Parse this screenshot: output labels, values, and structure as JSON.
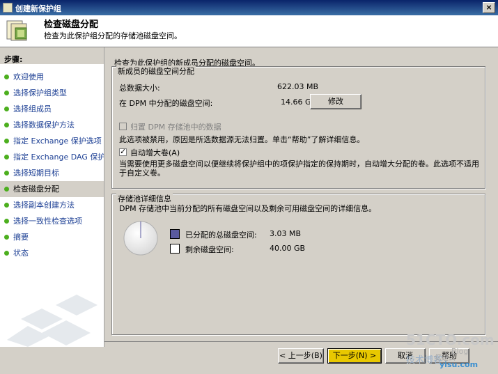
{
  "window": {
    "title": "创建新保护组",
    "close_glyph": "×"
  },
  "header": {
    "title": "检查磁盘分配",
    "subtitle": "检查为此保护组分配的存储池磁盘空间。"
  },
  "sidebar": {
    "heading": "步骤:",
    "items": [
      {
        "label": "欢迎使用"
      },
      {
        "label": "选择保护组类型"
      },
      {
        "label": "选择组成员"
      },
      {
        "label": "选择数据保护方法"
      },
      {
        "label": "指定 Exchange 保护选项"
      },
      {
        "label": "指定 Exchange DAG 保护"
      },
      {
        "label": "选择短期目标"
      },
      {
        "label": "检查磁盘分配",
        "active": true
      },
      {
        "label": "选择副本创建方法"
      },
      {
        "label": "选择一致性检查选项"
      },
      {
        "label": "摘要"
      },
      {
        "label": "状态"
      }
    ]
  },
  "main": {
    "intro": "检查为此保护组的新成员分配的磁盘空间。",
    "new_member_group": {
      "label": "新成员的磁盘空间分配",
      "total_size_label": "总数据大小:",
      "total_size_value": "622.03 MB",
      "dpm_space_label": "在 DPM 中分配的磁盘空间:",
      "dpm_space_value": "14.66 GB",
      "modify_button": "修改",
      "archive_checkbox_label": "归置 DPM 存储池中的数据",
      "archive_disabled_note": "此选项被禁用，原因是所选数据源无法归置。单击“帮助”了解详细信息。",
      "auto_grow_label": "自动增大卷(A)",
      "auto_grow_checked": true,
      "auto_grow_description": "当需要使用更多磁盘空间以便继续将保护组中的项保护指定的保持期时，自动增大分配的卷。此选项不适用于自定义卷。"
    },
    "pool_group": {
      "label": "存储池详细信息",
      "description": "DPM 存储池中当前分配的所有磁盘空间以及剩余可用磁盘空间的详细信息。",
      "allocated_label": "已分配的总磁盘空间:",
      "allocated_value": "3.03 MB",
      "free_label": "剩余磁盘空间:",
      "free_value": "40.00 GB",
      "allocated_color": "#5a5a9e",
      "free_color": "#ffffff",
      "allocated_fraction": 0.0001
    }
  },
  "footer": {
    "back_button": "< 上一步(B)",
    "next_button": "下一步(N) >",
    "cancel_button": "取消",
    "help_button": "帮助"
  },
  "watermark": {
    "site": "51CTO.com",
    "line2": "技术博客",
    "line3": "Blog",
    "line4": "亿速云",
    "line5": "yisu.com"
  }
}
